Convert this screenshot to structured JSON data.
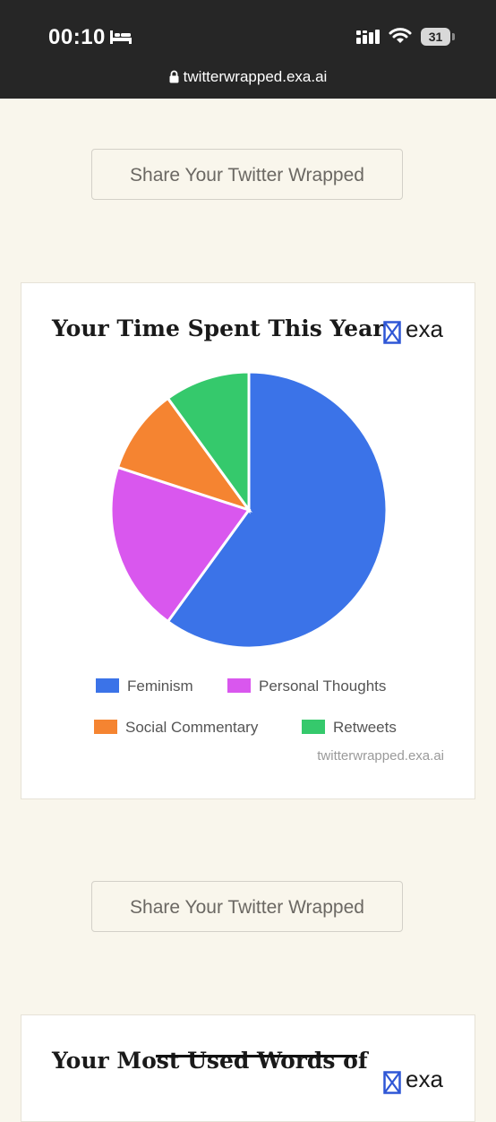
{
  "status_bar": {
    "time": "00:10",
    "battery": "31",
    "url": "twitterwrapped.exa.ai"
  },
  "share_button_label": "Share Your Twitter Wrapped",
  "card1": {
    "title": "Your Time Spent This Year",
    "logo_text": "exa",
    "watermark": "twitterwrapped.exa.ai"
  },
  "card2": {
    "title": "Your Most Used Words of",
    "logo_text": "exa"
  },
  "chart_data": {
    "type": "pie",
    "categories": [
      "Feminism",
      "Personal Thoughts",
      "Social Commentary",
      "Retweets"
    ],
    "values": [
      60,
      20,
      10,
      10
    ],
    "colors": [
      "#3b73e8",
      "#d957ee",
      "#f58431",
      "#35c96c"
    ],
    "legend_position": "bottom"
  },
  "colors": {
    "background": "#f9f6ec",
    "status_bar": "#262626",
    "exa_blue": "#2f57d6"
  }
}
